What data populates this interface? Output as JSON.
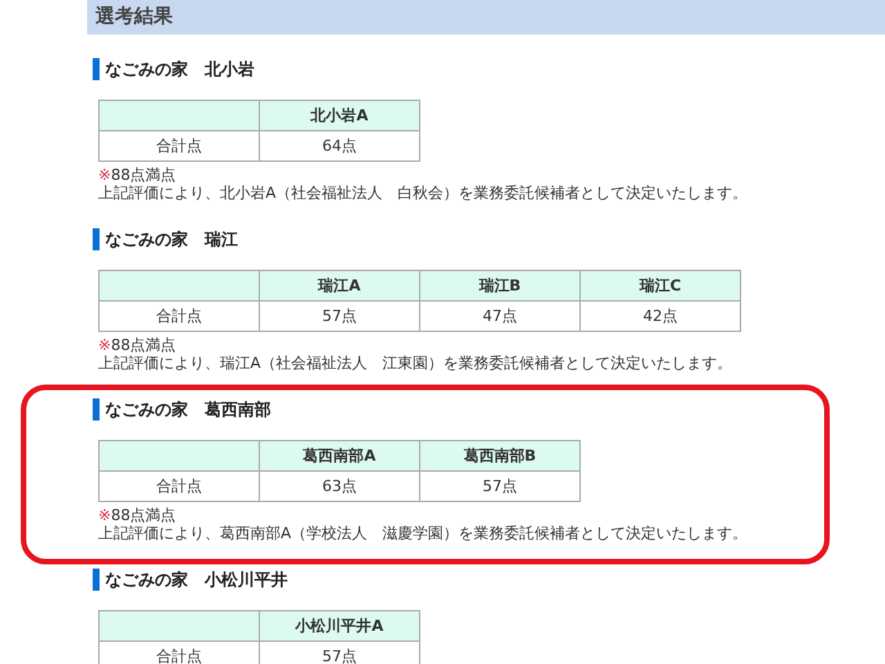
{
  "page_title": "選考結果",
  "sections": [
    {
      "title": "なごみの家　北小岩",
      "highlighted": false,
      "table": {
        "columns": [
          "北小岩A"
        ],
        "rows": [
          {
            "label": "合計点",
            "cells": [
              "64点"
            ]
          }
        ]
      },
      "note": {
        "symbol": "※",
        "text": "88点満点"
      },
      "decision": "上記評価により、北小岩A（社会福祉法人　白秋会）を業務委託候補者として決定いたします。"
    },
    {
      "title": "なごみの家　瑞江",
      "highlighted": false,
      "table": {
        "columns": [
          "瑞江A",
          "瑞江B",
          "瑞江C"
        ],
        "rows": [
          {
            "label": "合計点",
            "cells": [
              "57点",
              "47点",
              "42点"
            ]
          }
        ]
      },
      "note": {
        "symbol": "※",
        "text": "88点満点"
      },
      "decision": "上記評価により、瑞江A（社会福祉法人　江東園）を業務委託候補者として決定いたします。"
    },
    {
      "title": "なごみの家　葛西南部",
      "highlighted": true,
      "table": {
        "columns": [
          "葛西南部A",
          "葛西南部B"
        ],
        "rows": [
          {
            "label": "合計点",
            "cells": [
              "63点",
              "57点"
            ]
          }
        ]
      },
      "note": {
        "symbol": "※",
        "text": "88点満点"
      },
      "decision": "上記評価により、葛西南部A（学校法人　滋慶学園）を業務委託候補者として決定いたします。"
    },
    {
      "title": "なごみの家　小松川平井",
      "highlighted": false,
      "table": {
        "columns": [
          "小松川平井A"
        ],
        "rows": [
          {
            "label": "合計点",
            "cells": [
              "57点"
            ]
          }
        ]
      }
    }
  ]
}
